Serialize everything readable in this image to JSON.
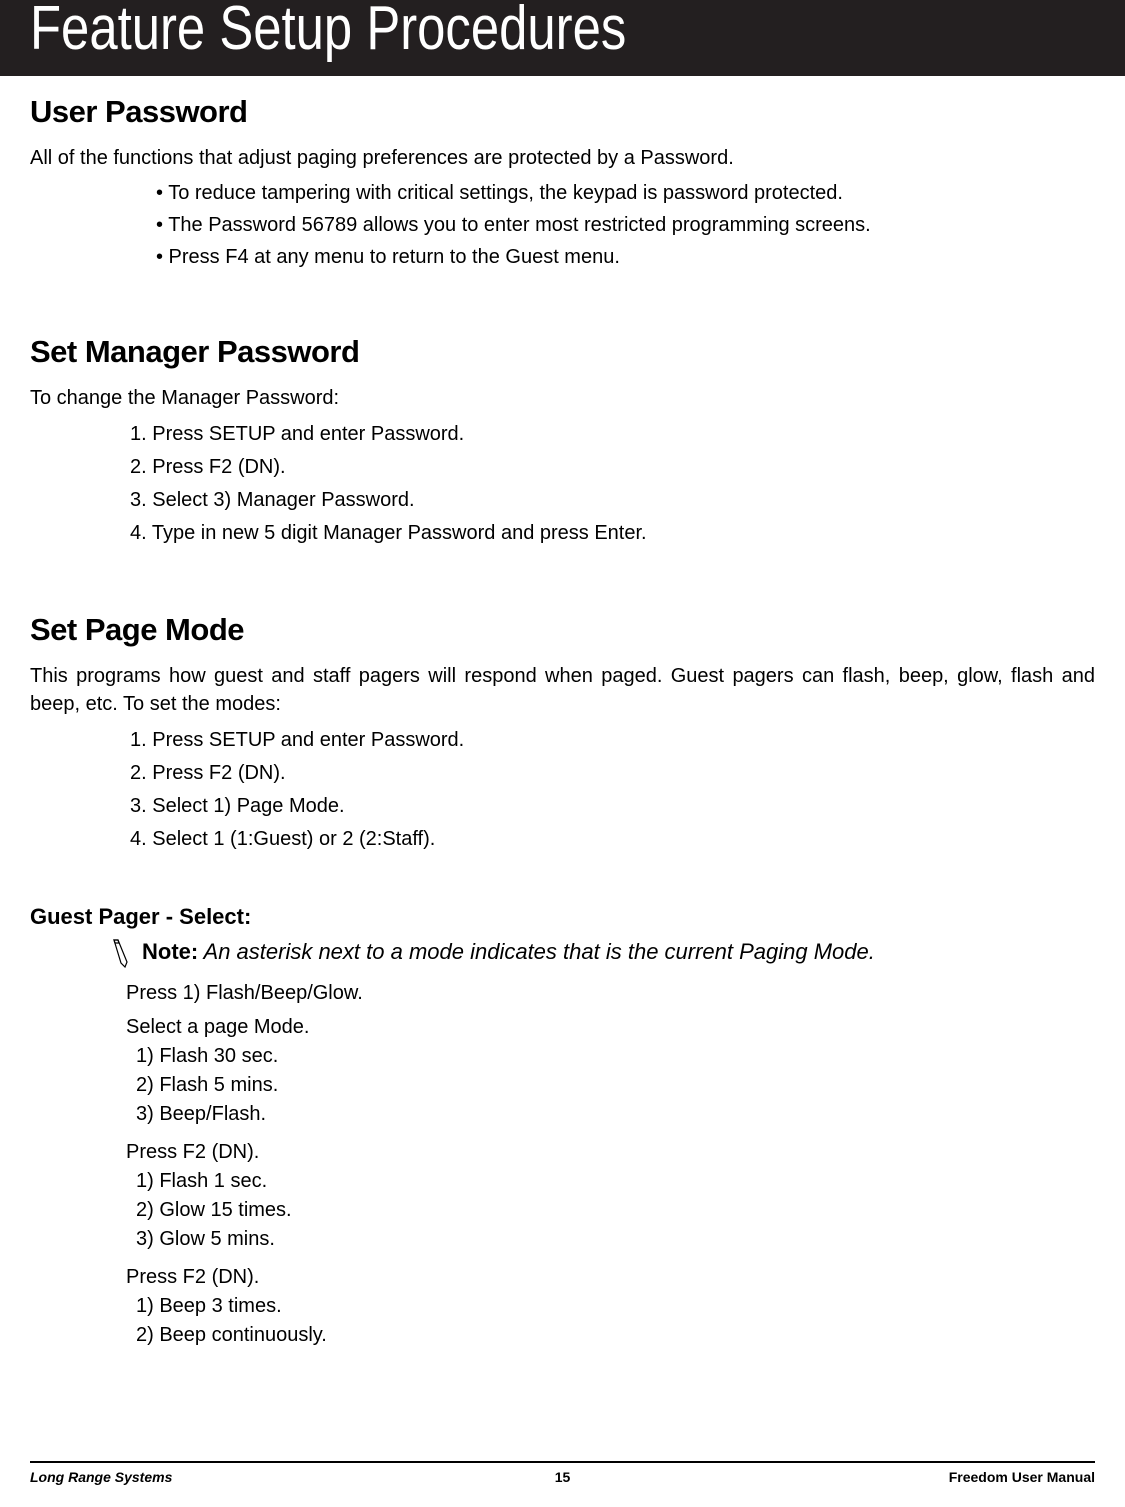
{
  "header": {
    "title": "Feature Setup Procedures"
  },
  "sections": {
    "user_password": {
      "heading": "User Password",
      "intro": "All of the functions that adjust paging preferences are protected by a Password.",
      "bullets": [
        "• To reduce tampering with critical settings, the keypad is password protected.",
        "• The Password 56789 allows you to enter most restricted programming screens.",
        "• Press F4 at any menu to return to the Guest menu."
      ]
    },
    "set_manager_password": {
      "heading": "Set Manager Password",
      "intro": "To change the Manager Password:",
      "steps": [
        "1. Press SETUP and enter Password.",
        "2. Press F2 (DN).",
        "3. Select 3) Manager Password.",
        "4. Type in new 5 digit Manager Password and press Enter."
      ]
    },
    "set_page_mode": {
      "heading": "Set Page Mode",
      "intro": "This programs how guest and staff pagers will respond when paged.  Guest pagers can flash, beep, glow, flash and beep, etc. To set the modes:",
      "steps": [
        "1. Press SETUP and enter Password.",
        "2. Press F2 (DN).",
        "3. Select 1) Page Mode.",
        "4. Select 1 (1:Guest) or 2 (2:Staff)."
      ]
    },
    "guest_pager": {
      "heading": "Guest Pager - Select:",
      "note_label": "Note:",
      "note_text": " An asterisk next to a mode indicates that is the current Paging Mode.",
      "block1_a": "Press 1) Flash/Beep/Glow.",
      "block1_b": "Select a page Mode.",
      "block1_items": [
        "1) Flash 30 sec.",
        "2) Flash 5 mins.",
        "3) Beep/Flash."
      ],
      "block2_a": "Press F2 (DN).",
      "block2_items": [
        "1) Flash 1 sec.",
        "2) Glow 15 times.",
        "3) Glow 5 mins."
      ],
      "block3_a": "Press F2 (DN).",
      "block3_items": [
        "1) Beep 3 times.",
        "2) Beep continuously."
      ]
    }
  },
  "footer": {
    "left": "Long Range Systems",
    "center": "15",
    "right": "Freedom User Manual"
  }
}
